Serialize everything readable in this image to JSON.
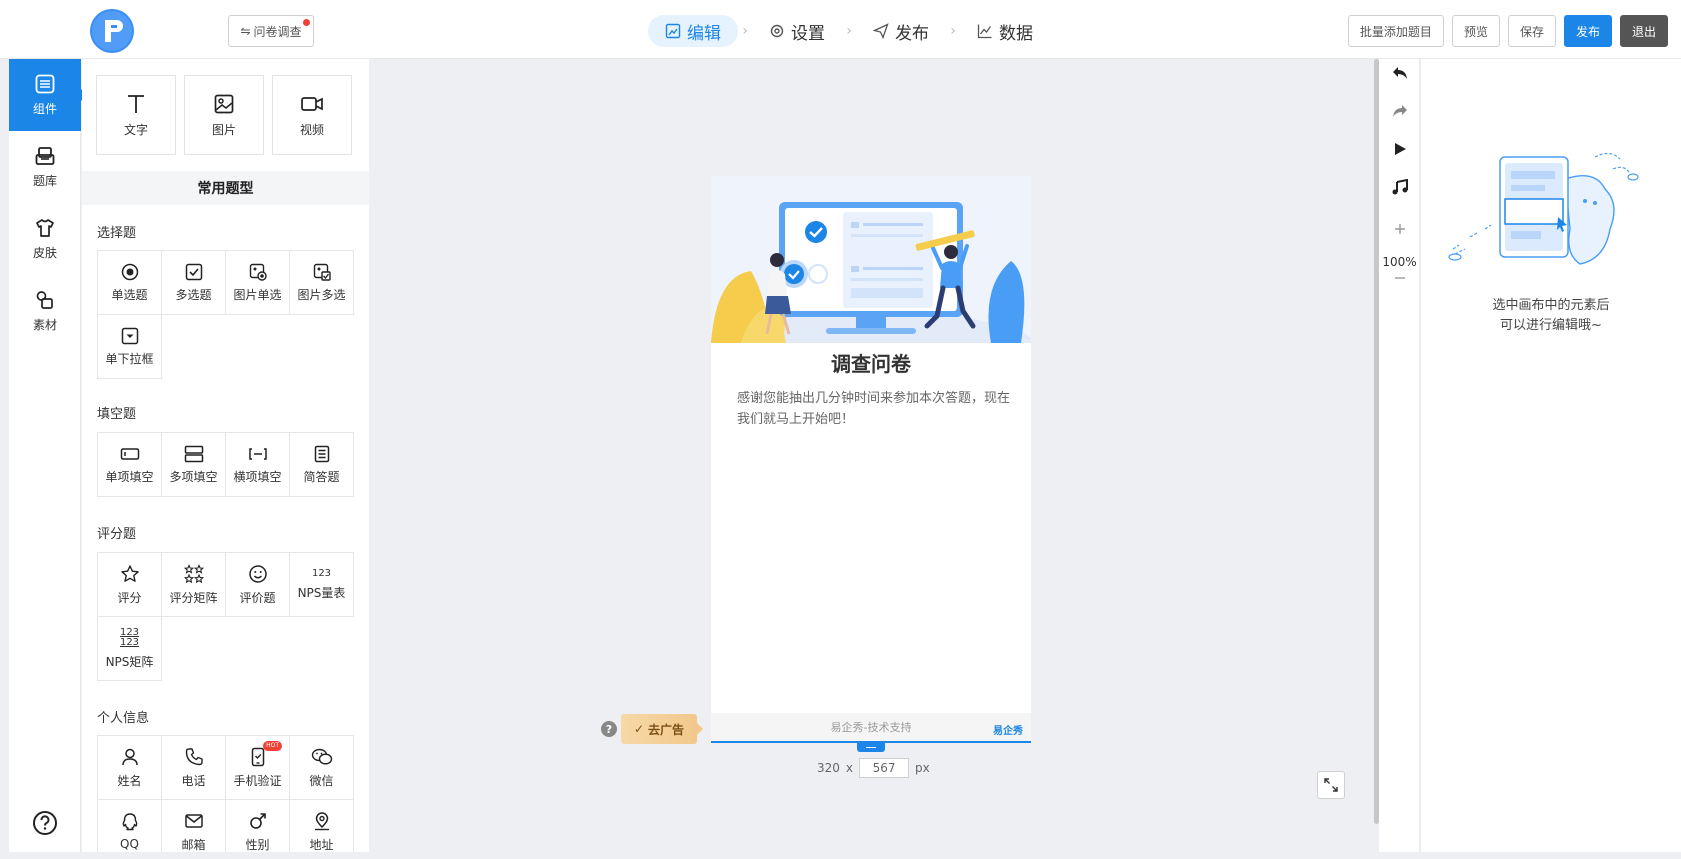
{
  "header": {
    "survey_type_label": "问卷调查",
    "steps": [
      {
        "label": "编辑",
        "active": true
      },
      {
        "label": "设置",
        "active": false
      },
      {
        "label": "发布",
        "active": false
      },
      {
        "label": "数据",
        "active": false
      }
    ],
    "actions": {
      "batch_add": "批量添加题目",
      "preview": "预览",
      "save": "保存",
      "publish": "发布",
      "exit": "退出"
    }
  },
  "rail": {
    "items": [
      {
        "label": "组件",
        "icon": "component-icon",
        "active": true
      },
      {
        "label": "题库",
        "icon": "question-bank-icon",
        "active": false
      },
      {
        "label": "皮肤",
        "icon": "skin-icon",
        "active": false
      },
      {
        "label": "素材",
        "icon": "material-icon",
        "active": false
      }
    ],
    "help_icon": "help-icon"
  },
  "panel": {
    "media": [
      {
        "label": "文字",
        "icon": "text-icon"
      },
      {
        "label": "图片",
        "icon": "image-icon"
      },
      {
        "label": "视频",
        "icon": "video-icon"
      }
    ],
    "title": "常用题型",
    "sections": {
      "choice": {
        "label": "选择题",
        "items": [
          "单选题",
          "多选题",
          "图片单选",
          "图片多选",
          "单下拉框"
        ]
      },
      "fill": {
        "label": "填空题",
        "items": [
          "单项填空",
          "多项填空",
          "横项填空",
          "简答题"
        ]
      },
      "rating": {
        "label": "评分题",
        "items": [
          "评分",
          "评分矩阵",
          "评价题",
          "NPS量表",
          "NPS矩阵"
        ],
        "nps_glyph": "123"
      },
      "personal": {
        "label": "个人信息",
        "items": [
          "姓名",
          "电话",
          "手机验证",
          "微信",
          "QQ",
          "邮箱",
          "性别",
          "地址"
        ],
        "hot_badge": "HOT"
      }
    }
  },
  "canvas": {
    "survey_title": "调查问卷",
    "survey_description": "感谢您能抽出几分钟时间来参加本次答题，现在我们就马上开始吧！",
    "footer_text": "易企秀-技术支持",
    "footer_brand": "易企秀",
    "ad_label": "去广告",
    "help_glyph": "?",
    "width_value": "320",
    "times_sign": "x",
    "height_value": "567",
    "unit": "px"
  },
  "tools": {
    "zoom": "100%"
  },
  "props": {
    "hint_line1": "选中画布中的元素后",
    "hint_line2": "可以进行编辑哦~"
  },
  "colors": {
    "accent": "#1b86e8",
    "canvas_bg": "#eeeff3"
  }
}
